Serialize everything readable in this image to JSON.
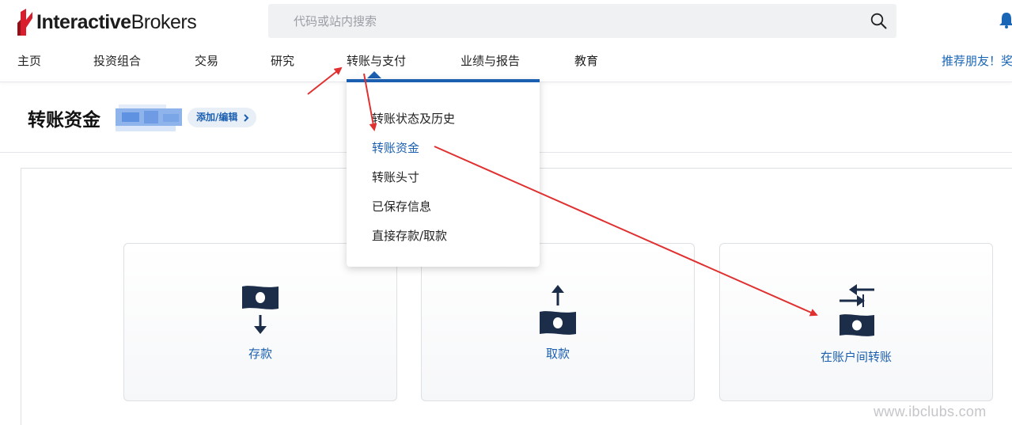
{
  "header": {
    "logo_bold": "Interactive",
    "logo_regular": "Brokers",
    "search_placeholder": "代码或站内搜索"
  },
  "nav": {
    "items": [
      "主页",
      "投资组合",
      "交易",
      "研究",
      "转账与支付",
      "业绩与报告",
      "教育"
    ],
    "active": "转账与支付",
    "right_link": "推荐朋友！奖"
  },
  "page": {
    "title": "转账资金",
    "add_edit_label": "添加/编辑"
  },
  "dropdown": {
    "items": [
      "转账状态及历史",
      "转账资金",
      "转账头寸",
      "已保存信息",
      "直接存款/取款"
    ],
    "active": "转账资金"
  },
  "cards": [
    {
      "label": "存款",
      "icon": "deposit-icon"
    },
    {
      "label": "取款",
      "icon": "withdraw-icon"
    },
    {
      "label": "在账户间转账",
      "icon": "transfer-between-accounts-icon"
    }
  ],
  "watermark": "www.ibclubs.com",
  "colors": {
    "accent": "#1b5fb0",
    "brand_red": "#d81e2c",
    "icon_navy": "#1c2d4a",
    "annotation_red": "#e03030"
  }
}
